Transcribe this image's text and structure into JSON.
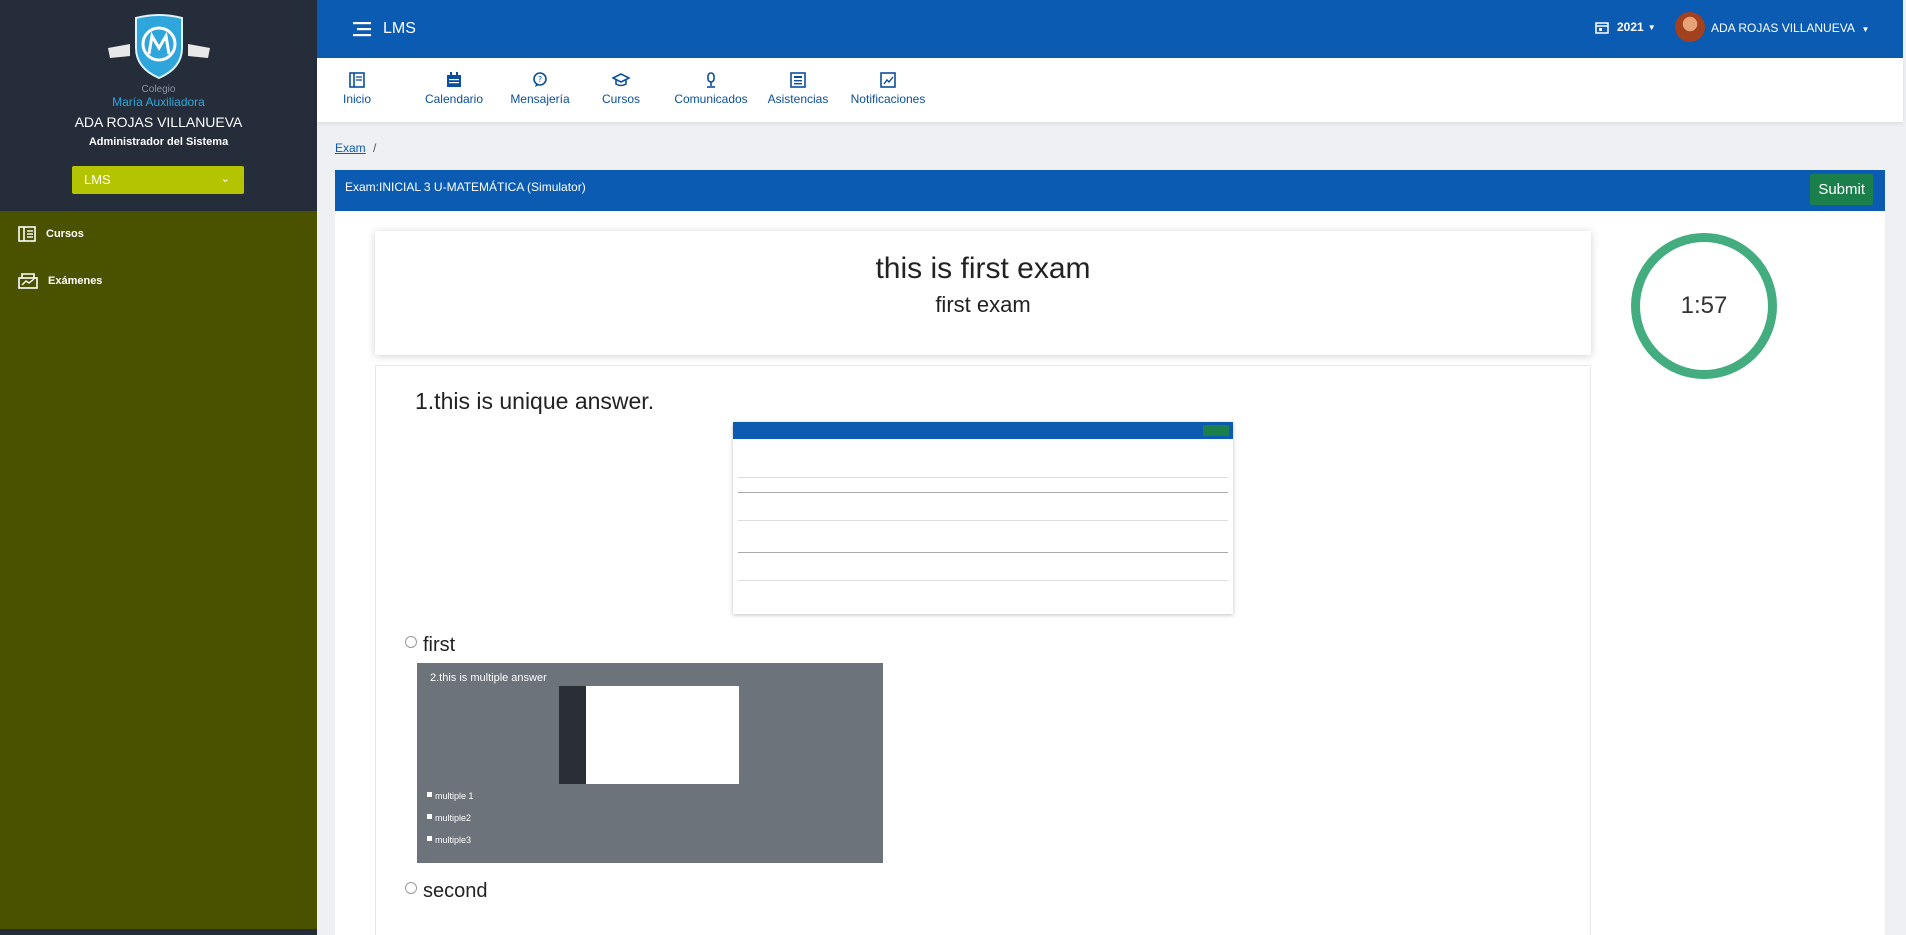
{
  "sidebar": {
    "brand_small": "Colegio",
    "brand_big": "María Auxiliadora",
    "user_name": "ADA ROJAS VILLANUEVA",
    "user_role": "Administrador del Sistema",
    "select_value": "LMS",
    "items": [
      {
        "label": "Cursos",
        "icon": "book-icon"
      },
      {
        "label": "Exámenes",
        "icon": "exam-icon"
      }
    ]
  },
  "header": {
    "app_title": "LMS",
    "year": "2021",
    "user_name": "ADA ROJAS VILLANUEVA"
  },
  "nav": [
    {
      "label": "Inicio",
      "icon": "home-icon"
    },
    {
      "label": "Calendario",
      "icon": "calendar-icon"
    },
    {
      "label": "Mensajería",
      "icon": "message-icon"
    },
    {
      "label": "Cursos",
      "icon": "graduation-cap-icon"
    },
    {
      "label": "Comunicados",
      "icon": "microphone-icon"
    },
    {
      "label": "Asistencias",
      "icon": "attendance-icon"
    },
    {
      "label": "Notificaciones",
      "icon": "chart-icon"
    }
  ],
  "breadcrumb": {
    "link": "Exam",
    "separator": "/"
  },
  "exam": {
    "header_title": "Exam:INICIAL 3 U-MATEMÁTICA (Simulator)",
    "submit_label": "Submit",
    "title": "this is first exam",
    "subtitle": "first exam",
    "timer": "1:57",
    "question": "1.this is unique answer.",
    "options": [
      {
        "label": "first"
      },
      {
        "label": "second"
      }
    ],
    "option_image": {
      "title": "2.this is multiple answer",
      "checks": [
        "multiple 1",
        "multiple2",
        "multiple3"
      ]
    }
  },
  "colors": {
    "primary": "#0a5bb1",
    "sidebar_top": "#252d3a",
    "sidebar_body": "#4a5200",
    "select": "#b5c400",
    "submit": "#1a7f4b",
    "timer_ring": "#43ad7f"
  }
}
